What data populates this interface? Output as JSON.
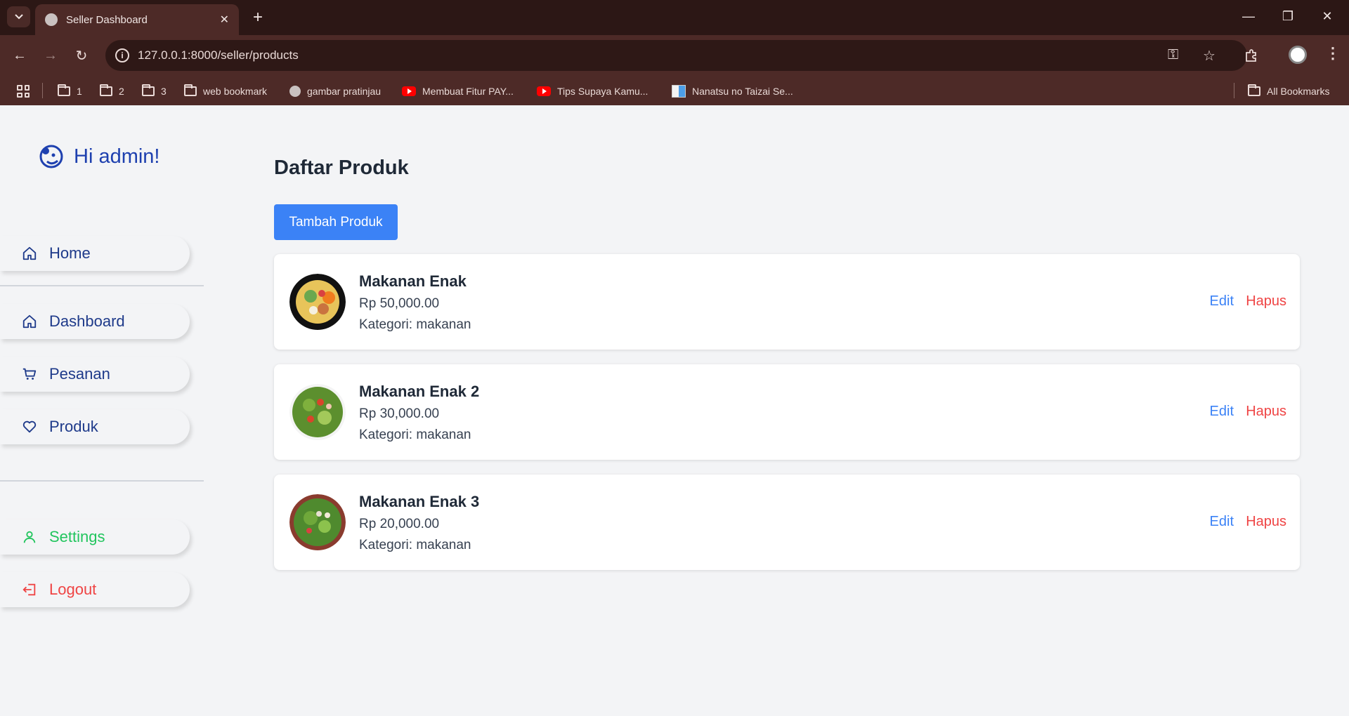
{
  "browser": {
    "tab_title": "Seller Dashboard",
    "url": "127.0.0.1:8000/seller/products",
    "bookmarks": [
      {
        "label": "1",
        "icon": "folder-icon"
      },
      {
        "label": "2",
        "icon": "folder-icon"
      },
      {
        "label": "3",
        "icon": "folder-icon"
      },
      {
        "label": "web bookmark",
        "icon": "folder-icon"
      },
      {
        "label": "gambar pratinjau",
        "icon": "globe-icon"
      },
      {
        "label": "Membuat Fitur PAY...",
        "icon": "youtube-icon"
      },
      {
        "label": "Tips Supaya Kamu...",
        "icon": "youtube-icon"
      },
      {
        "label": "Nanatsu no Taizai Se...",
        "icon": "book-icon"
      }
    ],
    "all_bookmarks": "All Bookmarks"
  },
  "sidebar": {
    "greeting": "Hi admin!",
    "items": [
      {
        "label": "Home",
        "icon": "home-icon"
      },
      {
        "label": "Dashboard",
        "icon": "home-icon"
      },
      {
        "label": "Pesanan",
        "icon": "cart-icon"
      },
      {
        "label": "Produk",
        "icon": "heart-icon"
      },
      {
        "label": "Settings",
        "icon": "user-icon"
      },
      {
        "label": "Logout",
        "icon": "logout-icon"
      }
    ]
  },
  "main": {
    "title": "Daftar Produk",
    "add_button": "Tambah Produk",
    "edit_label": "Edit",
    "delete_label": "Hapus",
    "products": [
      {
        "name": "Makanan Enak",
        "price": "Rp 50,000.00",
        "category": "Kategori: makanan"
      },
      {
        "name": "Makanan Enak 2",
        "price": "Rp 30,000.00",
        "category": "Kategori: makanan"
      },
      {
        "name": "Makanan Enak 3",
        "price": "Rp 20,000.00",
        "category": "Kategori: makanan"
      }
    ]
  },
  "colors": {
    "accent": "#3b82f6",
    "sidebar_text": "#1e3a8a",
    "settings": "#22c55e",
    "logout": "#ef4444",
    "browser_frame": "#4d2a27"
  }
}
